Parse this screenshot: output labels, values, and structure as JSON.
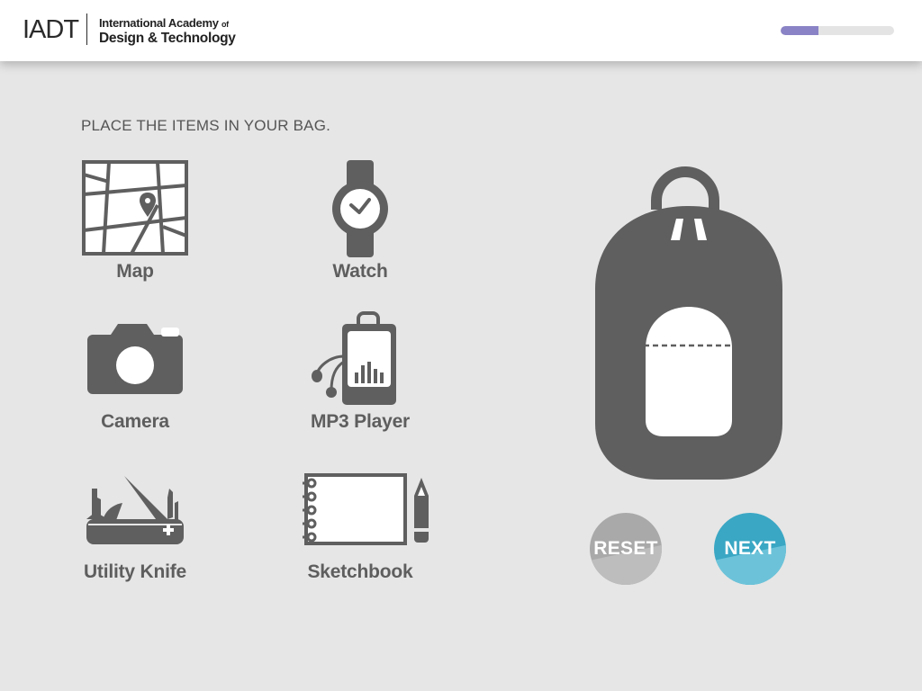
{
  "header": {
    "logo_mark": "IADT",
    "logo_line1": "International Academy",
    "logo_of": "of",
    "logo_line2": "Design & Technology",
    "progress_fraction": 0.33
  },
  "main": {
    "instruction": "PLACE THE ITEMS IN YOUR BAG.",
    "items": [
      {
        "label": "Map",
        "icon": "map-icon"
      },
      {
        "label": "Watch",
        "icon": "watch-icon"
      },
      {
        "label": "Camera",
        "icon": "camera-icon"
      },
      {
        "label": "MP3 Player",
        "icon": "mp3-player-icon"
      },
      {
        "label": "Utility Knife",
        "icon": "utility-knife-icon"
      },
      {
        "label": "Sketchbook",
        "icon": "sketchbook-icon"
      }
    ],
    "bag_icon": "backpack-icon"
  },
  "buttons": {
    "reset_label": "RESET",
    "next_label": "NEXT"
  },
  "colors": {
    "background": "#e6e6e6",
    "icon_gray": "#5f5f5f",
    "progress_fill": "#8a83c6",
    "next_button": "#3aa7c4",
    "reset_button": "#a9a9a9"
  }
}
